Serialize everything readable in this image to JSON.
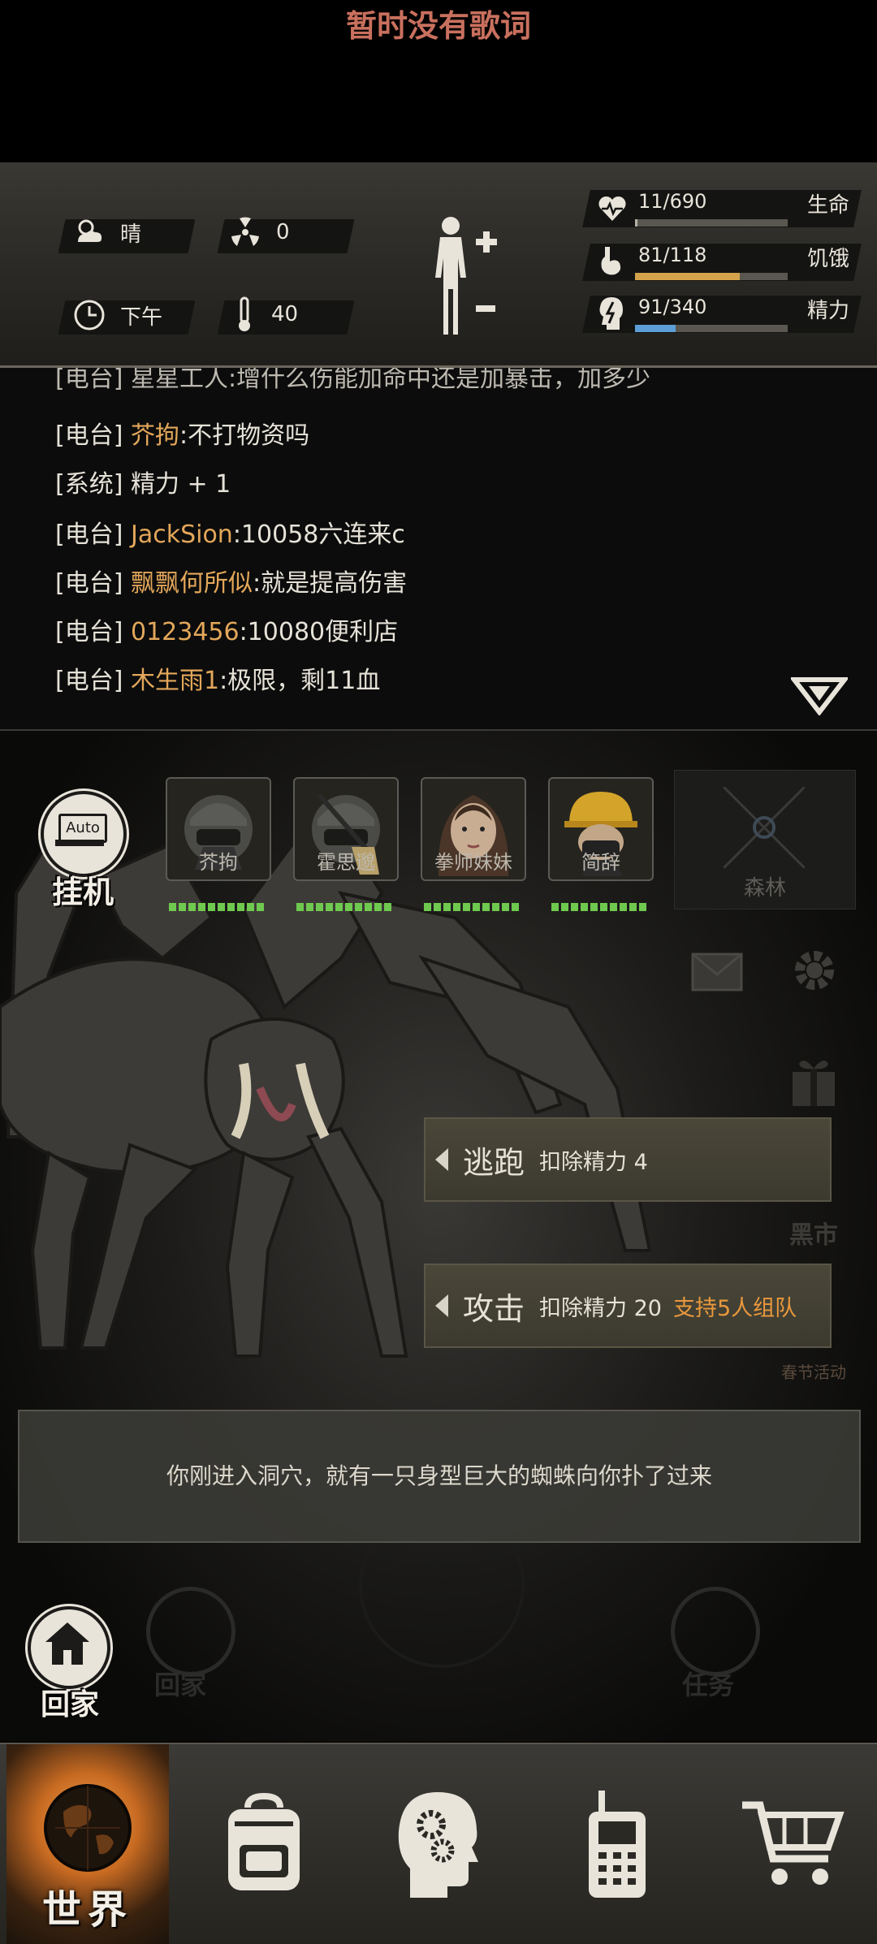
{
  "lyric_banner": "暂时没有歌词",
  "status": {
    "weather": "晴",
    "radiation": "0",
    "time_of_day": "下午",
    "temperature": "40",
    "health": {
      "value": "11/690",
      "label": "生命",
      "fraction": 0.016,
      "color": "#b6b2a8"
    },
    "hunger": {
      "value": "81/118",
      "label": "饥饿",
      "fraction": 0.686,
      "color": "#d3a24a"
    },
    "energy": {
      "value": "91/340",
      "label": "精力",
      "fraction": 0.268,
      "color": "#5b9fd6"
    }
  },
  "chat": {
    "partial_line": "[电台] 星星工人:增什么伤能加命中还是加暴击，加多少",
    "lines": [
      {
        "tag": "[电台]",
        "name": "芥拘",
        "text": ":不打物资吗"
      },
      {
        "tag": "[系统]",
        "name": "",
        "text": "精力 + 1",
        "system": true
      },
      {
        "tag": "[电台]",
        "name": "JackSion",
        "text": ":10058六连来c"
      },
      {
        "tag": "[电台]",
        "name": "飘飘何所似",
        "text": ":就是提高伤害"
      },
      {
        "tag": "[电台]",
        "name": "0123456",
        "text": ":10080便利店"
      },
      {
        "tag": "[电台]",
        "name": "木生雨1",
        "text": ":极限，剩11血"
      }
    ]
  },
  "auto_button": {
    "icon_text": "Auto",
    "label": "挂机"
  },
  "team": [
    {
      "name": "芥拘",
      "avatar": "gasmask-helmet"
    },
    {
      "name": "霍思邈",
      "avatar": "gasmask-helmet-rifle"
    },
    {
      "name": "拳师妹妹",
      "avatar": "woman-portrait"
    },
    {
      "name": "简辞",
      "avatar": "yellow-hardhat-mask"
    }
  ],
  "location_label": "森林",
  "side_labels": {
    "black_market": "黑市",
    "event": "春节活动"
  },
  "actions": [
    {
      "title": "逃跑",
      "cost": "扣除精力 4",
      "note": ""
    },
    {
      "title": "攻击",
      "cost": "扣除精力 20",
      "note": "支持5人组队"
    }
  ],
  "narration": "你刚进入洞穴，就有一只身型巨大的蜘蛛向你扑了过来",
  "ghost_labels": {
    "home_faint": "回家",
    "task": "任务"
  },
  "home_button": {
    "label": "回家"
  },
  "nav": {
    "world": "世界",
    "items": [
      "backpack-icon",
      "skills-head-icon",
      "radio-icon",
      "cart-icon"
    ]
  },
  "colors": {
    "accent_orange": "#e9983c",
    "name_orange": "#e3a75a",
    "hp_green": "#6fc94f"
  }
}
